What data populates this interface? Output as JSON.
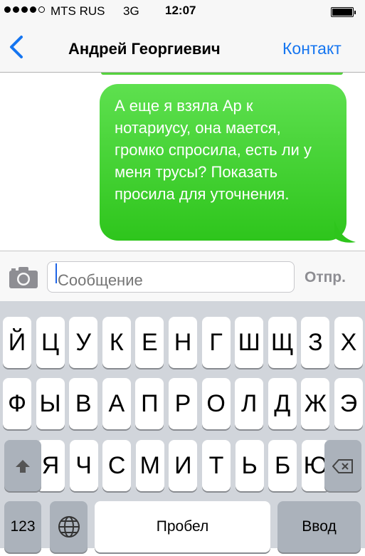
{
  "status_bar": {
    "carrier": "MTS RUS",
    "network": "3G",
    "time": "12:07",
    "signal_bars": 5,
    "signal_filled": 4
  },
  "nav": {
    "back_icon": "chevron-left-icon",
    "title": "Андрей Георгиевич",
    "contact_label": "Контакт"
  },
  "message": {
    "text": "А еще я взяла Ар к нотариусу, она мается, громко спросила, есть ли у меня трусы? Показать просила для уточнения.",
    "color": "#3fd22d"
  },
  "input": {
    "camera_icon": "camera-icon",
    "placeholder": "Сообщение",
    "send_label": "Отпр."
  },
  "keyboard": {
    "row1": [
      "Й",
      "Ц",
      "У",
      "К",
      "Е",
      "Н",
      "Г",
      "Ш",
      "Щ",
      "З",
      "Х"
    ],
    "row2": [
      "Ф",
      "Ы",
      "В",
      "А",
      "П",
      "Р",
      "О",
      "Л",
      "Д",
      "Ж",
      "Э"
    ],
    "row3": [
      "Я",
      "Ч",
      "С",
      "М",
      "И",
      "Т",
      "Ь",
      "Б",
      "Ю"
    ],
    "shift_icon": "shift-icon",
    "delete_icon": "delete-icon",
    "numbers_label": "123",
    "globe_icon": "globe-icon",
    "space_label": "Пробел",
    "return_label": "Ввод"
  }
}
